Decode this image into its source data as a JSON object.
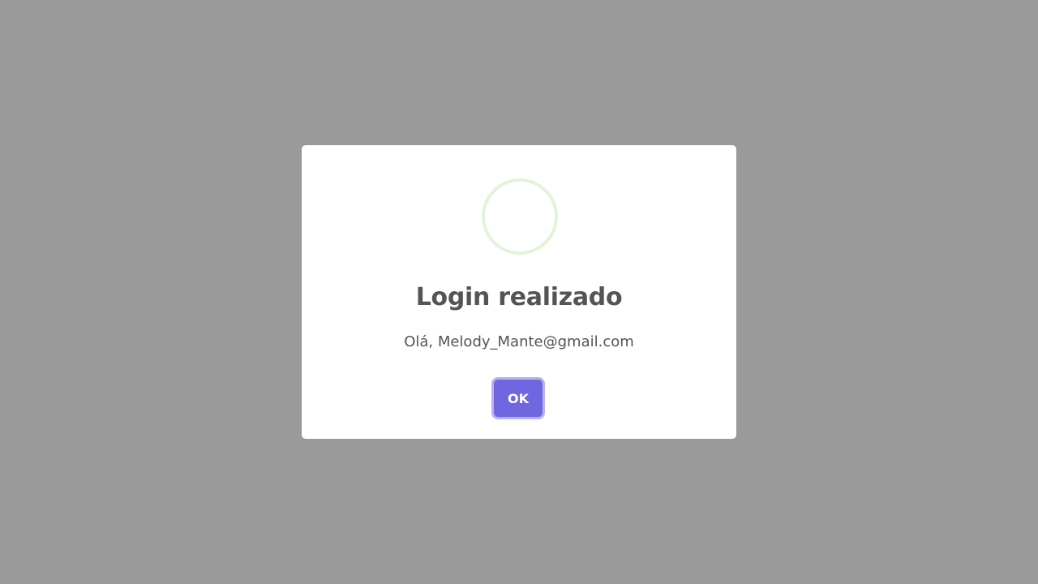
{
  "dialog": {
    "icon": "success-circle-icon",
    "icon_color": "#e3f3d8",
    "title": "Login realizado",
    "message": "Olá, Melody_Mante@gmail.com",
    "confirm_label": "OK",
    "confirm_color": "#7066e0"
  }
}
